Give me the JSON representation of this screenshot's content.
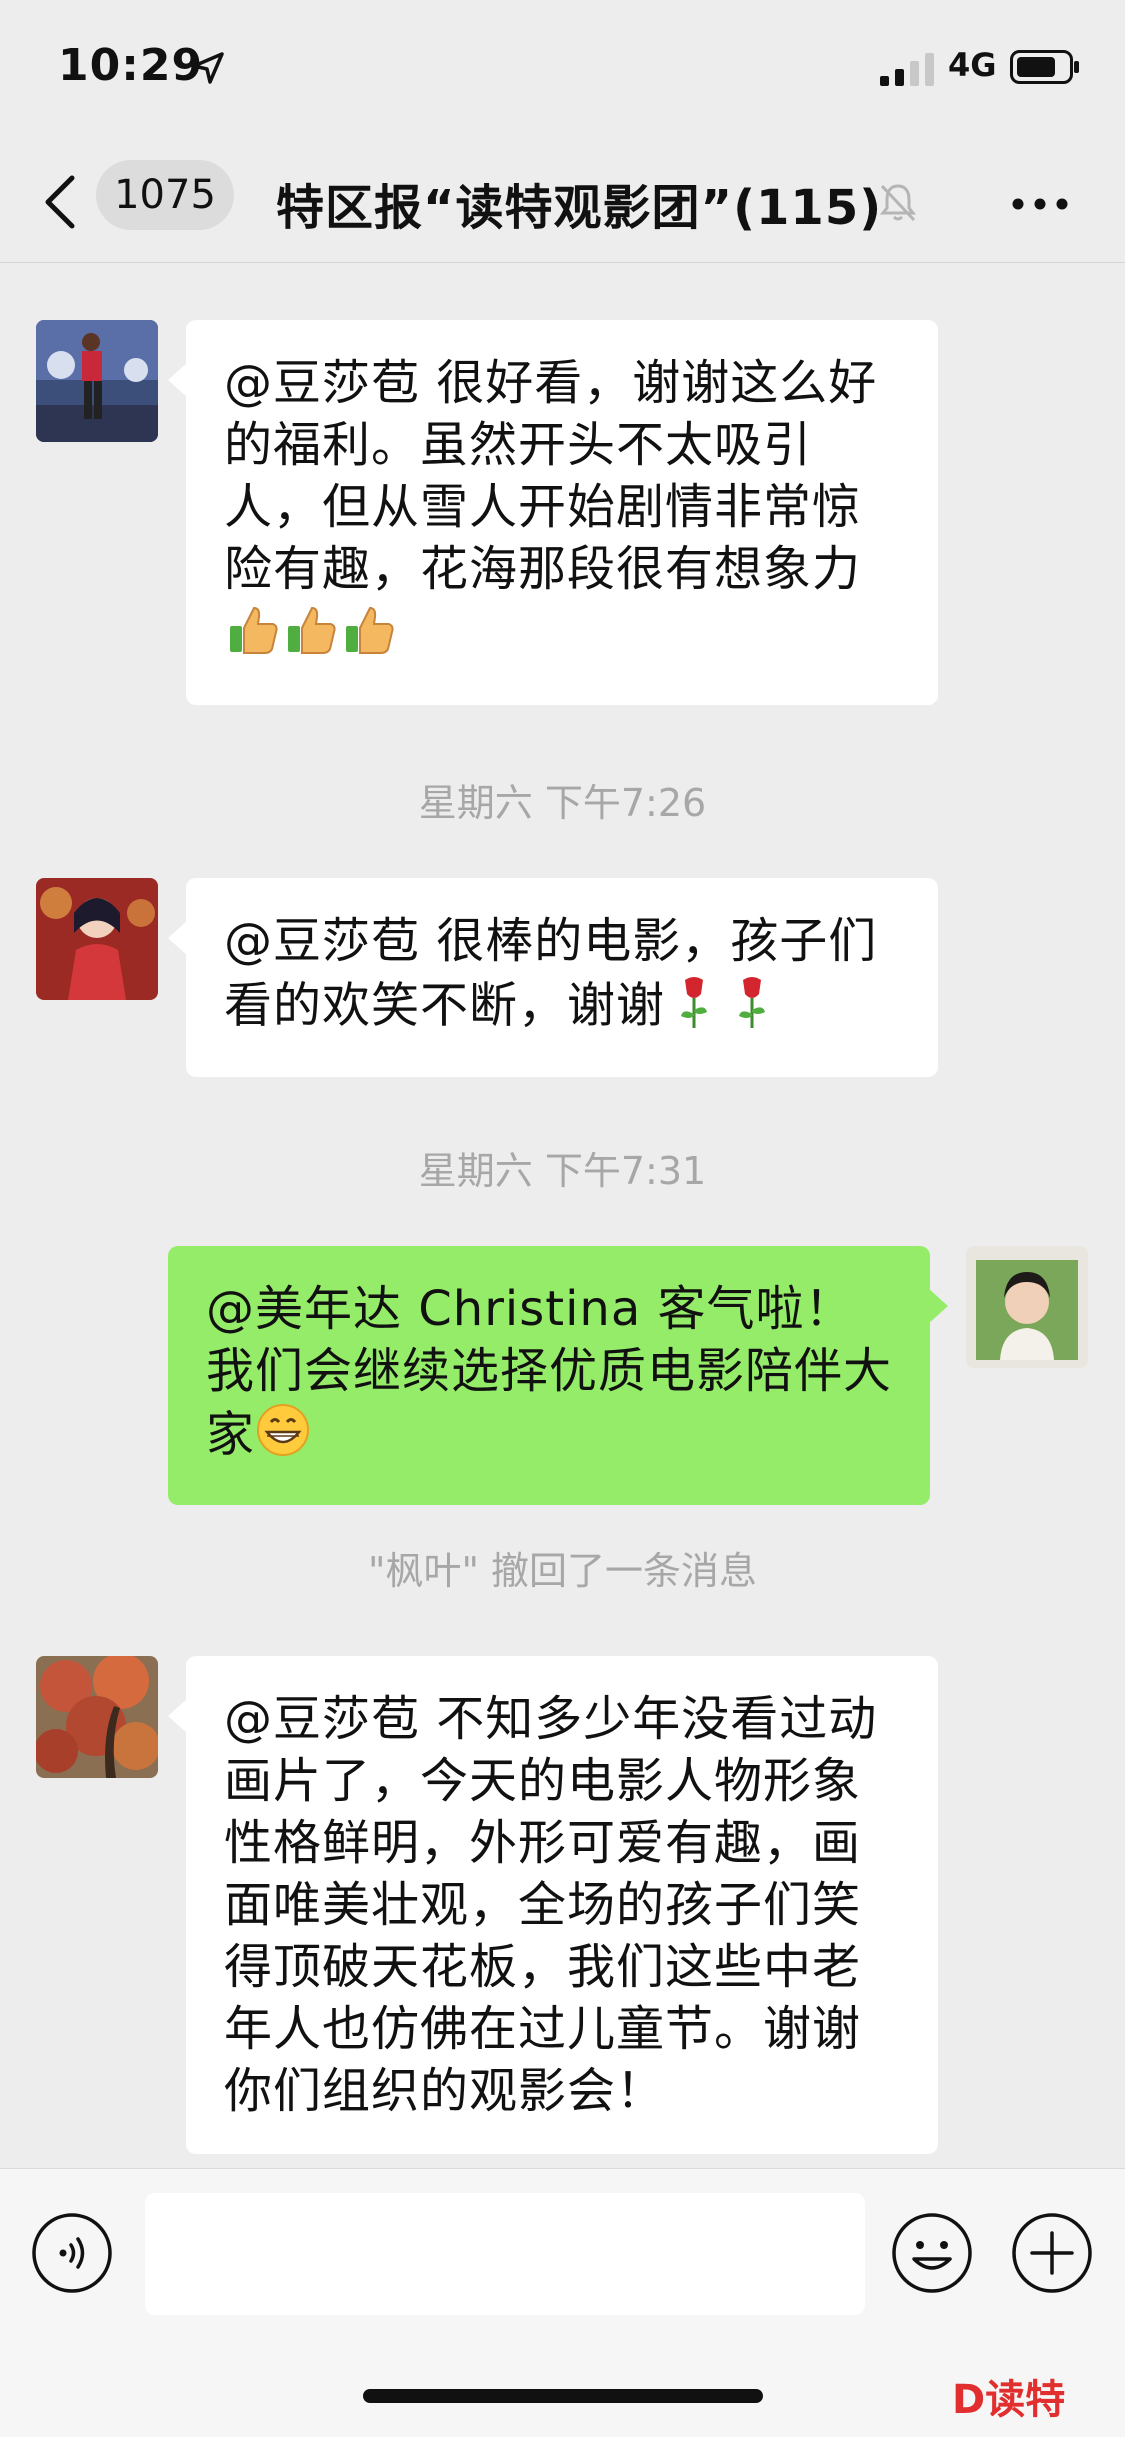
{
  "status_bar": {
    "time": "10:29",
    "network": "4G"
  },
  "nav": {
    "unread_count": "1075",
    "title": "特区报“读特观影团”(115)"
  },
  "messages": [
    {
      "text": "@豆莎苞 很好看，谢谢这么好的福利。虽然开头不太吸引人，但从雪人开始剧情非常惊险有趣，花海那段很有想象力",
      "emoji": [
        "thumbs-up-icon",
        "thumbs-up-icon",
        "thumbs-up-icon"
      ]
    },
    {
      "timestamp": "星期六 下午7:26"
    },
    {
      "text": "@豆莎苞 很棒的电影，孩子们看的欢笑不断，谢谢",
      "emoji": [
        "rose-icon",
        "rose-icon"
      ]
    },
    {
      "timestamp": "星期六 下午7:31"
    },
    {
      "text": "@美年达 Christina 客气啦！我们会继续选择优质电影陪伴大家",
      "emoji": [
        "grin-icon"
      ]
    },
    {
      "system": "\"枫叶\" 撤回了一条消息"
    },
    {
      "text": "@豆莎苞 不知多少年没看过动画片了，今天的电影人物形象性格鲜明，外形可爱有趣，画面唯美壮观，全场的孩子们笑得顶破天花板，我们这些中老年人也仿佛在过儿童节。谢谢你们组织的观影会！"
    }
  ],
  "watermark": "D读特",
  "colors": {
    "background": "#ededed",
    "bubble_sent": "#95ec69",
    "bubble_received": "#ffffff",
    "timestamp": "#a7a7a7"
  }
}
